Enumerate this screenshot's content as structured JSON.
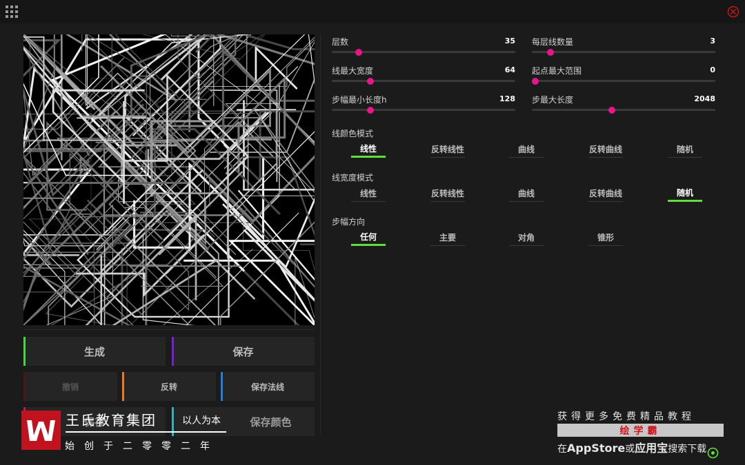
{
  "sliders": [
    {
      "label": "层数",
      "value": "35",
      "fraction": 0.145
    },
    {
      "label": "每层线数量",
      "value": "3",
      "fraction": 0.1
    },
    {
      "label": "线最大宽度",
      "value": "64",
      "fraction": 0.21
    },
    {
      "label": "起点最大范围",
      "value": "0",
      "fraction": 0.02
    },
    {
      "label": "步幅最小长度h",
      "value": "128",
      "fraction": 0.21
    },
    {
      "label": "步最大长度",
      "value": "2048",
      "fraction": 0.435
    }
  ],
  "sections": [
    {
      "label": "线颜色模式",
      "options": [
        "线性",
        "反转线性",
        "曲线",
        "反转曲线",
        "随机"
      ],
      "active": 0
    },
    {
      "label": "线宽度模式",
      "options": [
        "线性",
        "反转线性",
        "曲线",
        "反转曲线",
        "随机"
      ],
      "active": 4
    },
    {
      "label": "步幅方向",
      "options": [
        "任何",
        "主要",
        "对角",
        "锥形"
      ],
      "active": 0
    }
  ],
  "buttons": {
    "generate": "生成",
    "save": "保存",
    "undo": "撤销",
    "invert": "反转",
    "save_normal": "保存法线",
    "save_color": "保存颜色",
    "left_hidden": "保存"
  },
  "accents": {
    "generate": "#3ddc3a",
    "save": "#7b1fd6",
    "undo": "#4a1818",
    "invert": "#f07a1a",
    "save_normal": "#1f7fe0",
    "save_color": "#2bb3c8",
    "left_hidden": "#c2185b"
  },
  "colors": {
    "thumb": "#e8168a",
    "active_underline": "#5ee03e"
  },
  "icons": {
    "menu": "grid-icon",
    "close": "close-icon",
    "target": "target-icon"
  },
  "watermark": {
    "logo_letter": "W",
    "title": "王氏教育集团",
    "slogan": "以人为本",
    "sub": "始创于二零零二年"
  },
  "promo": {
    "line1": "获得更多免费精品教程",
    "bar": "绘学霸",
    "line2_pre": "在",
    "line2_store": "AppStore",
    "line2_mid": "或",
    "line2_app": "应用宝",
    "line2_post": "搜索下载"
  }
}
